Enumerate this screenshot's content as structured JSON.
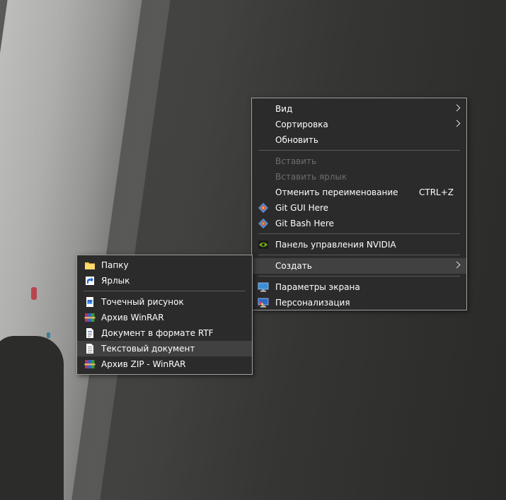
{
  "main_menu": {
    "view": "Вид",
    "sort": "Сортировка",
    "refresh": "Обновить",
    "paste": "Вставить",
    "paste_shortcut": "Вставить ярлык",
    "undo_rename": "Отменить переименование",
    "undo_rename_hotkey": "CTRL+Z",
    "git_gui": "Git GUI Here",
    "git_bash": "Git Bash Here",
    "nvidia": "Панель управления NVIDIA",
    "create": "Создать",
    "display_settings": "Параметры экрана",
    "personalize": "Персонализация"
  },
  "sub_menu": {
    "folder": "Папку",
    "shortcut": "Ярлык",
    "bitmap": "Точечный рисунок",
    "winrar_archive": "Архив WinRAR",
    "rtf_document": "Документ в формате RTF",
    "text_document": "Текстовый документ",
    "zip_archive": "Архив ZIP - WinRAR"
  },
  "icons": {
    "git": "git-diamond-icon",
    "nvidia": "nvidia-eye-icon",
    "display": "monitor-icon",
    "personalize": "monitor-paint-icon",
    "folder": "folder-icon",
    "shortcut": "shortcut-arrow-icon",
    "bitmap": "image-file-icon",
    "winrar": "winrar-books-icon",
    "rtf": "rtf-doc-icon",
    "text": "text-file-icon"
  },
  "colors": {
    "menu_bg": "#2b2b2b",
    "menu_border": "#a0a0a0",
    "highlight": "#414141",
    "disabled_text": "#6d6d6d",
    "separator": "#5a5a5a"
  }
}
